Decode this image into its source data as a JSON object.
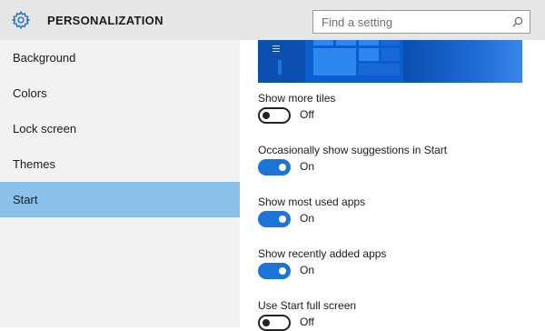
{
  "header": {
    "title": "PERSONALIZATION",
    "app_icon": "gear-icon",
    "search": {
      "placeholder": "Find a setting",
      "value": "",
      "icon": "search-icon"
    }
  },
  "sidebar": {
    "items": [
      {
        "label": "Background",
        "active": false
      },
      {
        "label": "Colors",
        "active": false
      },
      {
        "label": "Lock screen",
        "active": false
      },
      {
        "label": "Themes",
        "active": false
      },
      {
        "label": "Start",
        "active": true
      }
    ],
    "active_color": "#89c1ea"
  },
  "settings": [
    {
      "label": "Show more tiles",
      "state": "Off",
      "on": false
    },
    {
      "label": "Occasionally show suggestions in Start",
      "state": "On",
      "on": true
    },
    {
      "label": "Show most used apps",
      "state": "On",
      "on": true
    },
    {
      "label": "Show recently added apps",
      "state": "On",
      "on": true
    },
    {
      "label": "Use Start full screen",
      "state": "Off",
      "on": false
    }
  ],
  "colors": {
    "accent": "#1e74d6",
    "header_bg": "#e6e6e6",
    "sidebar_bg": "#f2f2f2",
    "preview_bg": "#0a5ed0"
  }
}
